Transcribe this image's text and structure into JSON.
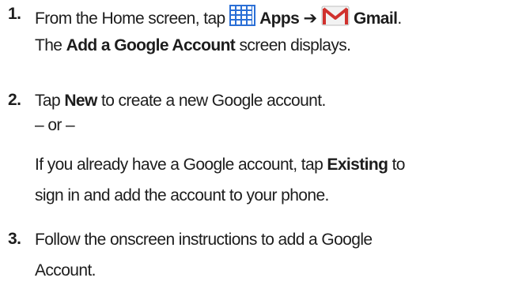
{
  "steps": [
    {
      "number": "1.",
      "line1": {
        "pre": "From the Home screen, tap",
        "apps_label": "Apps",
        "arrow": "➔",
        "gmail_label": "Gmail",
        "post": "."
      },
      "line2": {
        "pre": "The",
        "bold": "Add a Google Account",
        "post": "screen displays."
      }
    },
    {
      "number": "2.",
      "line1": {
        "pre": "Tap",
        "bold": "New",
        "post": "to create a new Google account."
      },
      "or_text": "– or –",
      "line3": {
        "pre": "If you already have a Google account, tap",
        "bold": "Existing",
        "post": "to"
      },
      "line4": "sign in and add the account to your phone."
    },
    {
      "number": "3.",
      "line1": "Follow the onscreen instructions to add a Google",
      "line2": "Account."
    }
  ],
  "icons": {
    "apps": "apps-grid-icon",
    "gmail": "gmail-envelope-icon"
  },
  "colors": {
    "text": "#1d1d1d",
    "apps_icon": "#2a6fd6",
    "gmail_red": "#d0312d"
  }
}
